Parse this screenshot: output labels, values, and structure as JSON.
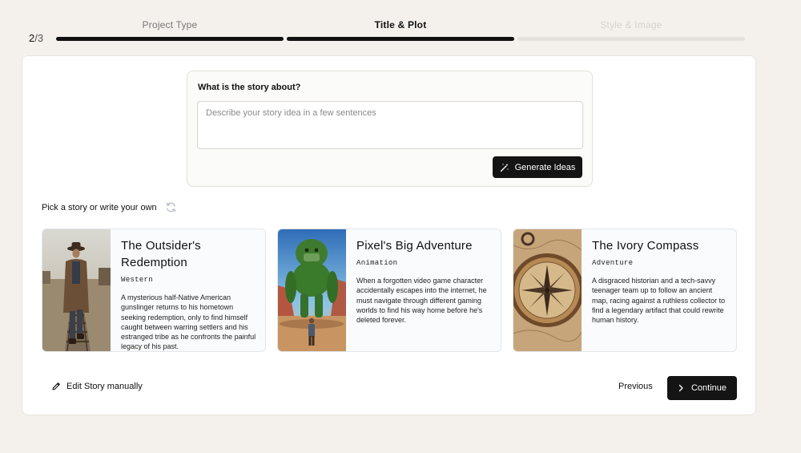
{
  "stepper": {
    "current": "2",
    "total": "/3",
    "steps": [
      {
        "label": "Project Type",
        "state": "done"
      },
      {
        "label": "Title & Plot",
        "state": "active"
      },
      {
        "label": "Style & Image",
        "state": "todo"
      }
    ]
  },
  "prompt": {
    "label": "What is the story about?",
    "placeholder": "Describe your story idea in a few sentences",
    "value": "",
    "generate_label": "Generate Ideas",
    "generate_icon": "magic-wand-icon"
  },
  "pick": {
    "label": "Pick a story or write your own",
    "refresh_icon": "refresh-icon"
  },
  "stories": [
    {
      "title": "The Outsider's Redemption",
      "genre": "Western",
      "description": "A mysterious half-Native American gunslinger returns to his hometown seeking redemption, only to find himself caught between warring settlers and his estranged tribe as he confronts the painful legacy of his past.",
      "image": "cowboy-on-railroad-tracks"
    },
    {
      "title": "Pixel's Big Adventure",
      "genre": "Animation",
      "description": "When a forgotten video game character accidentally escapes into the internet, he must navigate through different gaming worlds to find his way home before he's deleted forever.",
      "image": "giant-moss-golem"
    },
    {
      "title": "The Ivory Compass",
      "genre": "Adventure",
      "description": "A disgraced historian and a tech-savvy teenager team up to follow an ancient map, racing against a ruthless collector to find a legendary artifact that could rewrite human history.",
      "image": "antique-compass"
    }
  ],
  "footer": {
    "edit_label": "Edit Story manually",
    "edit_icon": "pencil-icon",
    "previous_label": "Previous",
    "continue_label": "Continue",
    "continue_icon": "chevron-right-icon"
  }
}
